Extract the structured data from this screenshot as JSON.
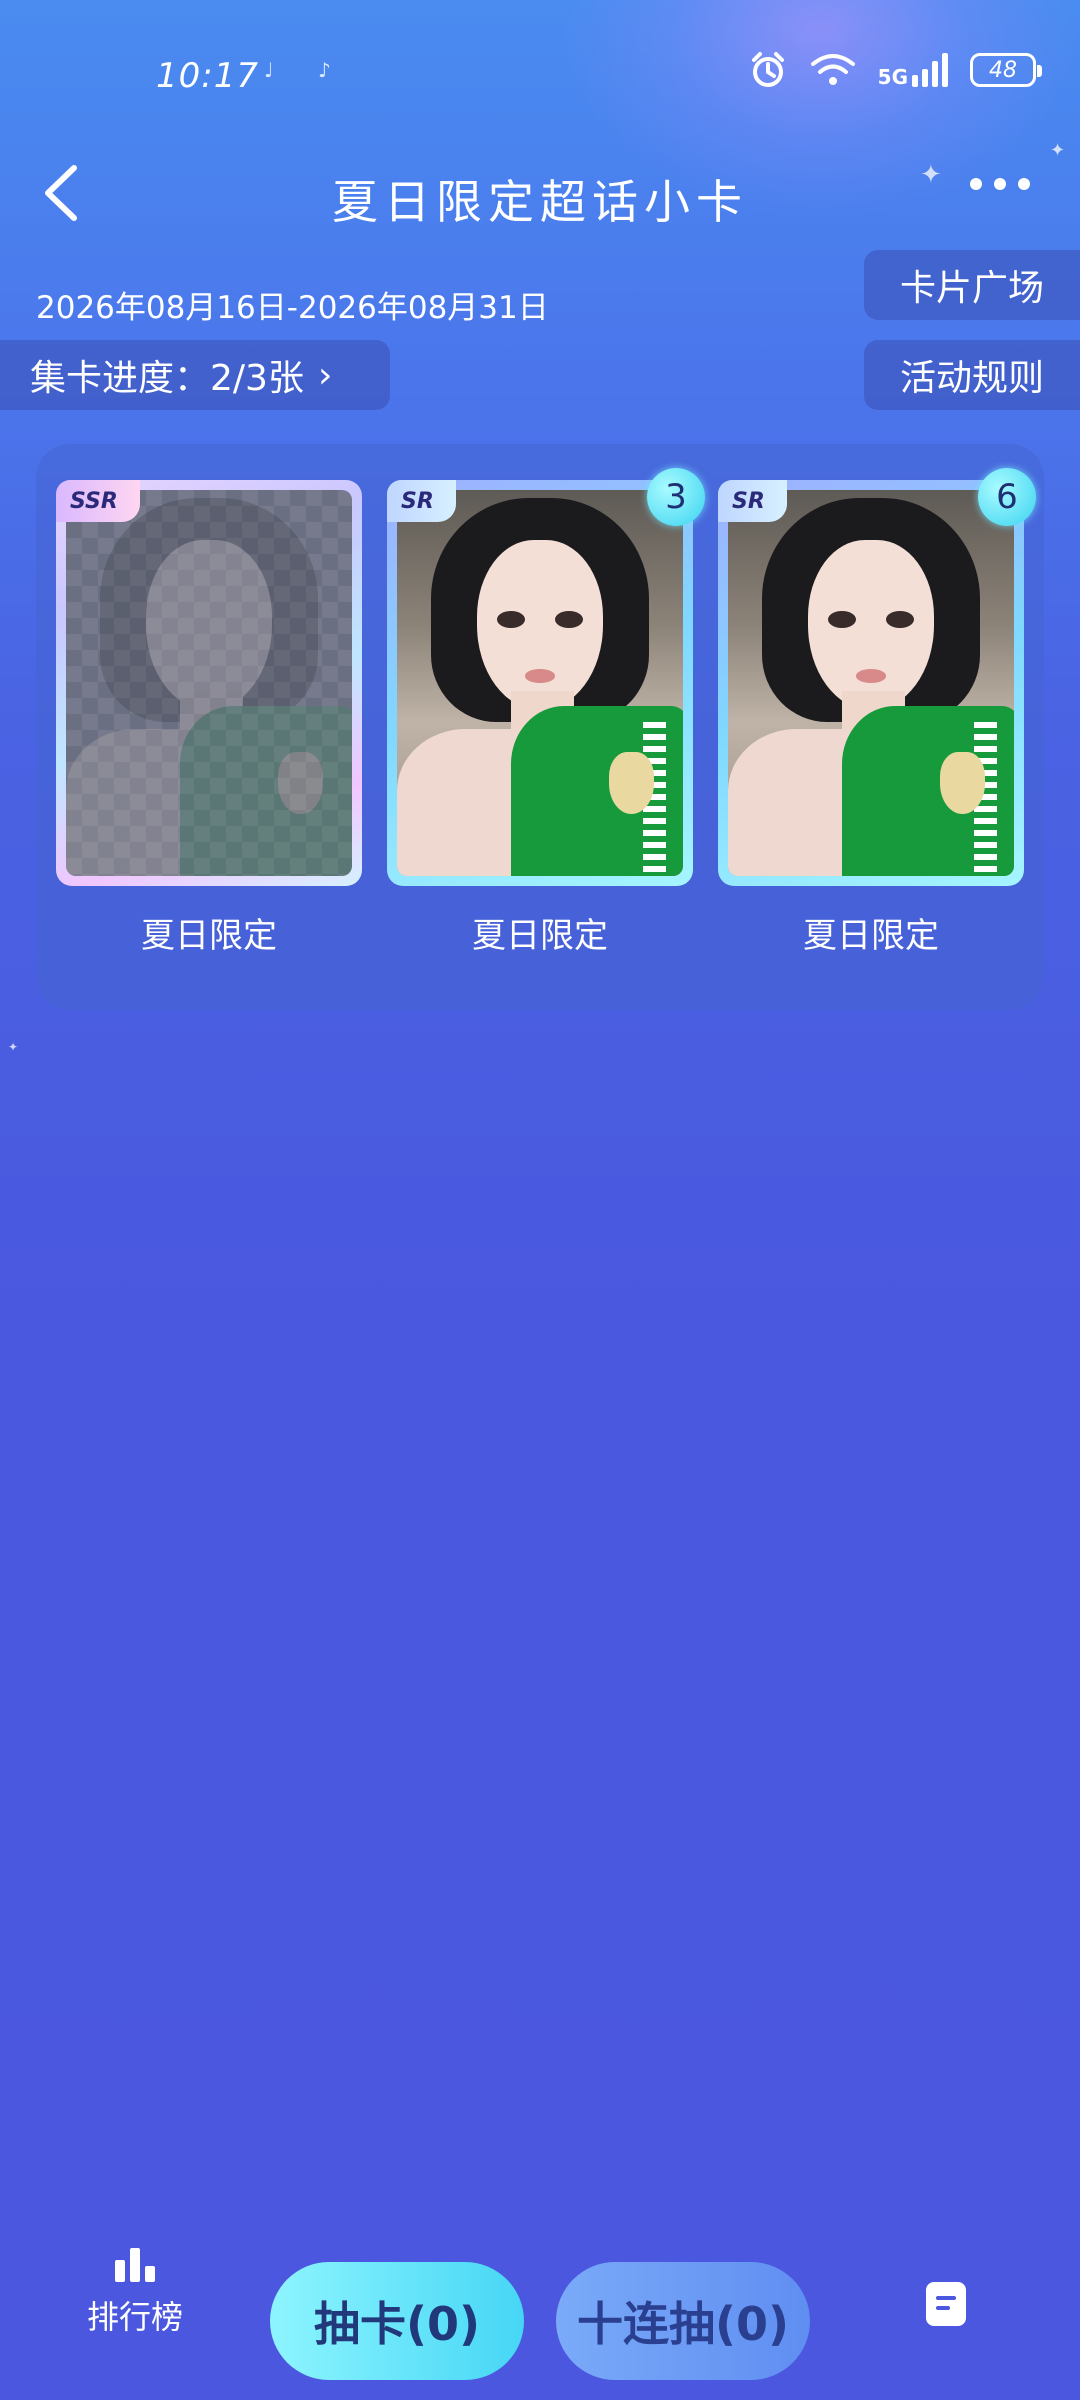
{
  "status_bar": {
    "time": "10:17",
    "network": "5G",
    "battery": "48"
  },
  "header": {
    "title": "夏日限定超话小卡"
  },
  "event": {
    "date_range": "2026年08月16日-2026年08月31日",
    "card_plaza": "卡片广场",
    "rules": "活动规则",
    "progress_label": "集卡进度：",
    "progress_value": "2/3张",
    "progress_arrow": "›",
    "collected": 2,
    "total": 3
  },
  "cards": [
    {
      "rarity": "SSR",
      "name": "夏日限定",
      "count": "",
      "locked": true
    },
    {
      "rarity": "SR",
      "name": "夏日限定",
      "count": "3",
      "locked": false
    },
    {
      "rarity": "SR",
      "name": "夏日限定",
      "count": "6",
      "locked": false
    }
  ],
  "bottom_bar": {
    "ranking": "排行榜",
    "draw_one": "抽卡(0)",
    "draw_ten": "十连抽(0)"
  },
  "colors": {
    "background_top": "#4a8cf0",
    "background": "#4b57df",
    "draw_button": "#46d6f5",
    "badge": "#3ad3f0"
  },
  "icons": [
    "back-arrow-icon",
    "more-dots-icon",
    "alarm-icon",
    "wifi-icon",
    "signal-icon",
    "battery-icon",
    "ranking-bars-icon",
    "notes-icon"
  ]
}
